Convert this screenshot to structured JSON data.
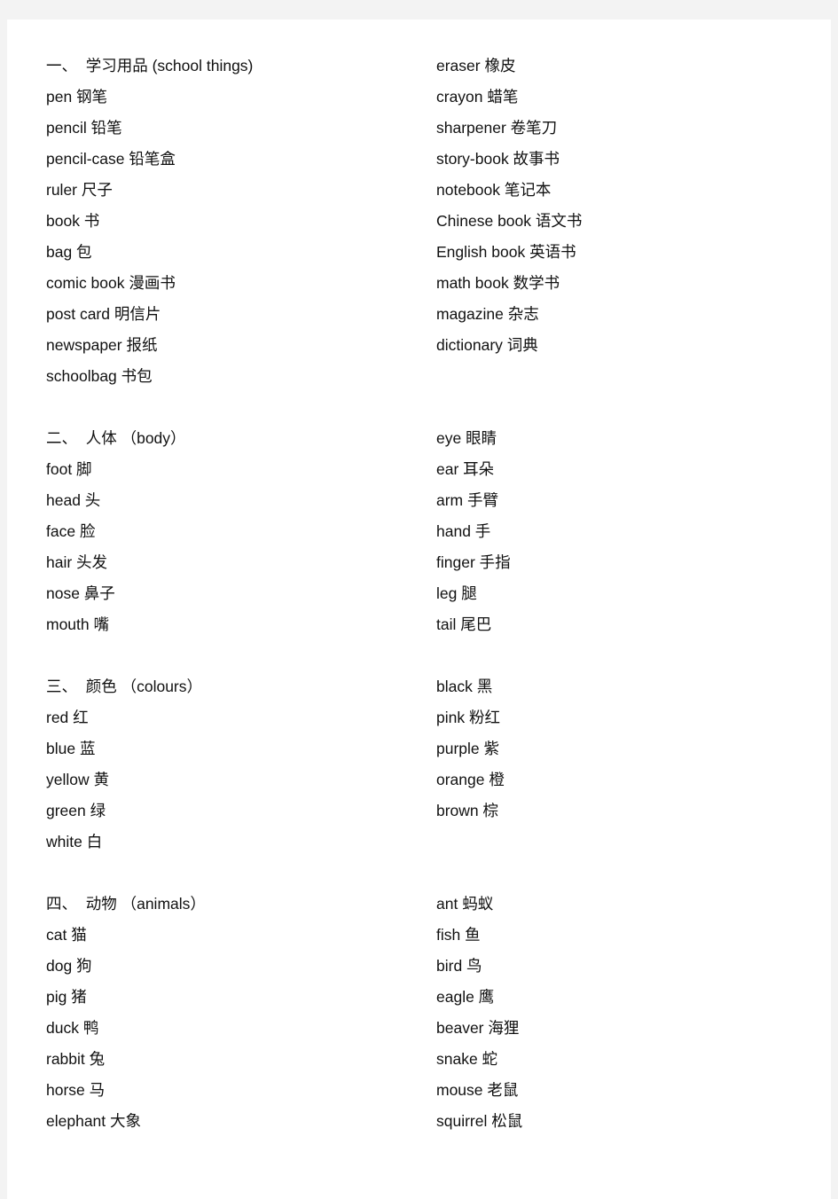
{
  "sections": [
    {
      "left": [
        "一、  学习用品 (school things)",
        "pen 钢笔",
        "pencil 铅笔",
        "pencil-case 铅笔盒",
        "ruler 尺子",
        "book 书",
        "bag 包",
        "comic book 漫画书",
        "post card 明信片",
        "newspaper 报纸",
        "schoolbag 书包"
      ],
      "right": [
        "eraser 橡皮",
        "crayon 蜡笔",
        "sharpener 卷笔刀",
        "story-book 故事书",
        "notebook 笔记本",
        "Chinese book 语文书",
        "English book 英语书",
        "math book 数学书",
        "magazine 杂志",
        "dictionary 词典"
      ]
    },
    {
      "left": [
        "二、  人体 （body）",
        "foot 脚",
        "head 头",
        "face 脸",
        "hair 头发",
        "nose 鼻子",
        "mouth 嘴"
      ],
      "right": [
        "eye 眼睛",
        "ear 耳朵",
        "arm 手臂",
        "hand 手",
        "finger 手指",
        "leg 腿",
        "tail 尾巴"
      ]
    },
    {
      "left": [
        "三、  颜色 （colours）",
        "red 红",
        "blue 蓝",
        "yellow 黄",
        "green 绿",
        "white 白"
      ],
      "right": [
        "black 黑",
        "pink 粉红",
        "purple 紫",
        "orange 橙",
        "brown 棕"
      ]
    },
    {
      "left": [
        "四、  动物 （animals）",
        "cat 猫",
        "dog 狗",
        "pig 猪",
        "duck 鸭",
        "rabbit 兔",
        "horse 马",
        "elephant 大象"
      ],
      "right": [
        "ant 蚂蚁",
        "fish 鱼",
        "bird 鸟",
        "eagle 鹰",
        "beaver 海狸",
        "snake 蛇",
        "mouse 老鼠",
        "squirrel 松鼠"
      ]
    }
  ]
}
